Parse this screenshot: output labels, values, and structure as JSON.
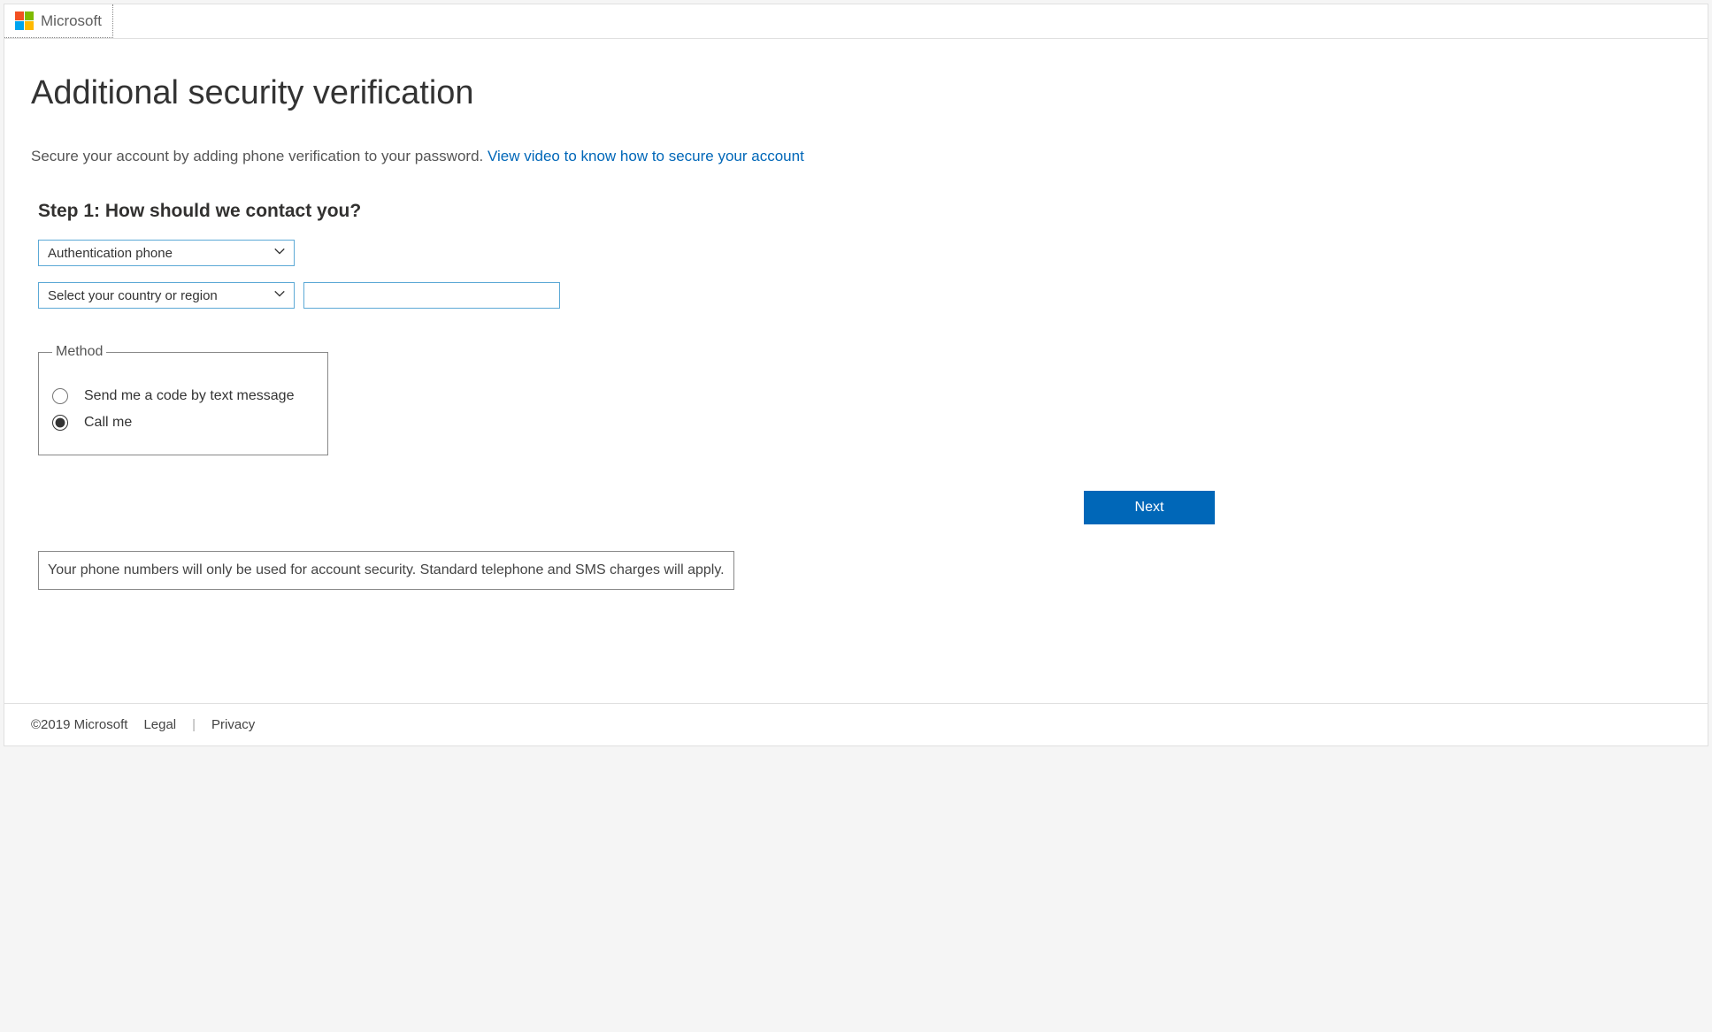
{
  "header": {
    "brand": "Microsoft"
  },
  "main": {
    "title": "Additional security verification",
    "subtitle_text": "Secure your account by adding phone verification to your password. ",
    "subtitle_link": "View video to know how to secure your account",
    "step_title": "Step 1: How should we contact you?",
    "contact_method_select": "Authentication phone",
    "country_select": "Select your country or region",
    "phone_value": "",
    "method": {
      "legend": "Method",
      "option_text": "Send me a code by text message",
      "option_call": "Call me",
      "selected": "call"
    },
    "next_button": "Next",
    "notice": "Your phone numbers will only be used for account security. Standard telephone and SMS charges will apply."
  },
  "footer": {
    "copyright": "©2019 Microsoft",
    "legal": "Legal",
    "privacy": "Privacy"
  }
}
